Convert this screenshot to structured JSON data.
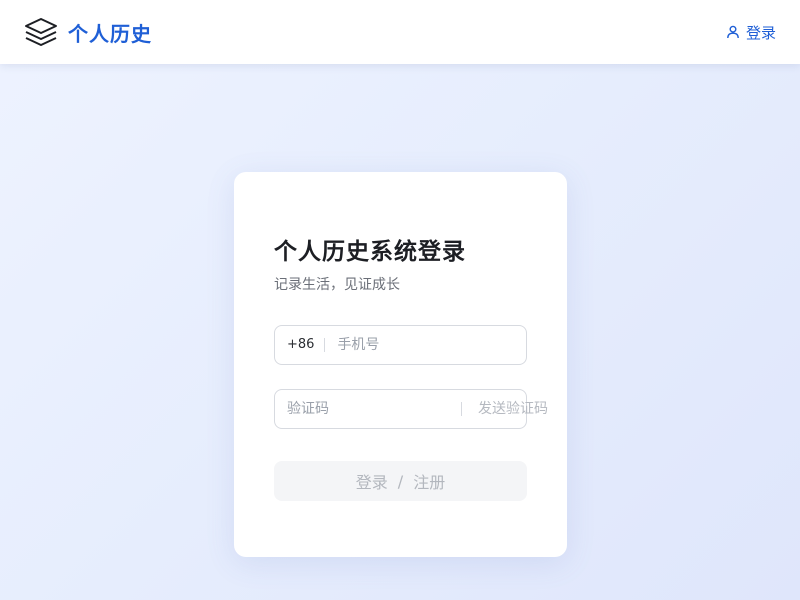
{
  "header": {
    "brand_title": "个人历史",
    "logo_icon": "layers-icon",
    "login_label": "登录",
    "login_icon": "user-icon",
    "accent_color": "#1f5fd6"
  },
  "login_card": {
    "title": "个人历史系统登录",
    "subtitle": "记录生活，见证成长",
    "phone": {
      "prefix": "+86",
      "placeholder": "手机号",
      "value": ""
    },
    "code": {
      "placeholder": "验证码",
      "value": "",
      "send_label": "发送验证码"
    },
    "submit": {
      "login_label": "登录",
      "separator": "/",
      "register_label": "注册",
      "disabled": true
    }
  }
}
